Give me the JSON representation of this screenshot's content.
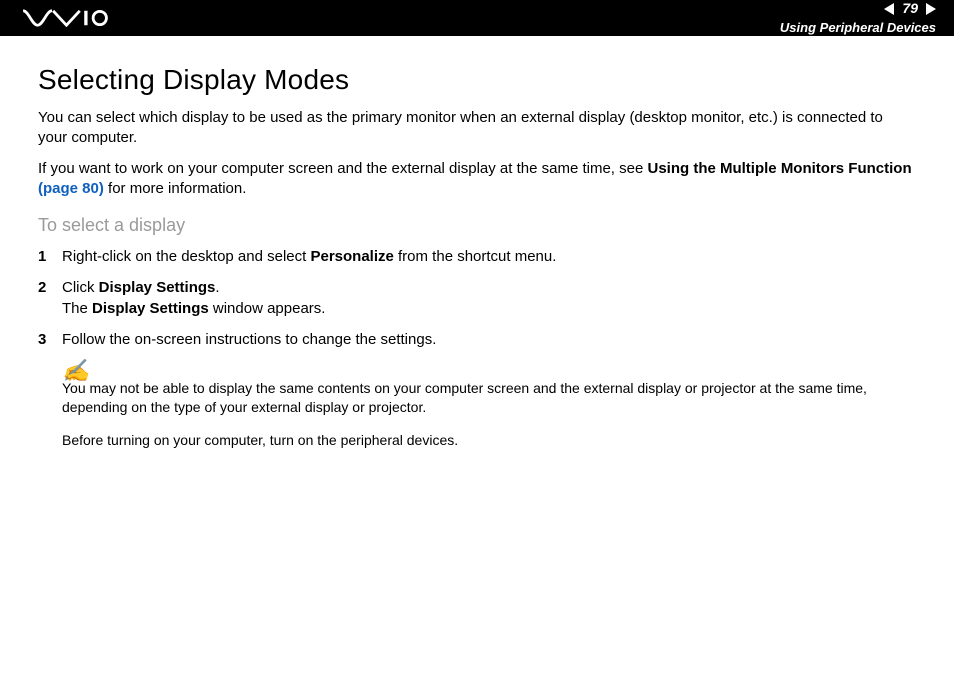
{
  "header": {
    "page_number": "79",
    "section": "Using Peripheral Devices"
  },
  "title": "Selecting Display Modes",
  "para1": {
    "text": "You can select which display to be used as the primary monitor when an external display (desktop monitor, etc.) is connected to your computer."
  },
  "para2": {
    "pre": "If you want to work on your computer screen and the external display at the same time, see ",
    "bold1": "Using the Multiple Monitors Function ",
    "link": "(page 80)",
    "post": " for more information."
  },
  "subheading": "To select a display",
  "steps": [
    {
      "pre": "Right-click on the desktop and select ",
      "b1": "Personalize",
      "post": " from the shortcut menu."
    },
    {
      "pre": "Click ",
      "b1": "Display Settings",
      "mid": ".\nThe ",
      "b2": "Display Settings",
      "post": " window appears."
    },
    {
      "pre": "Follow the on-screen instructions to change the settings."
    }
  ],
  "note": {
    "n1": "You may not be able to display the same contents on your computer screen and the external display or projector at the same time, depending on the type of your external display or projector.",
    "n2": "Before turning on your computer, turn on the peripheral devices."
  }
}
